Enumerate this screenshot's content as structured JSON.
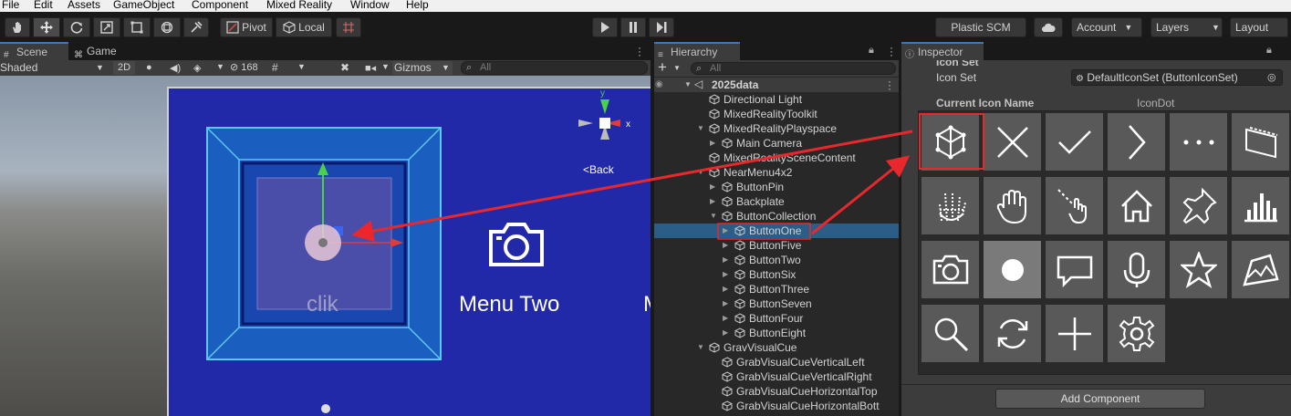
{
  "menu": [
    "File",
    "Edit",
    "Assets",
    "GameObject",
    "Component",
    "Mixed Reality",
    "Window",
    "Help"
  ],
  "toolbar": {
    "pivot_label": "Pivot",
    "local_label": "Local",
    "plastic_label": "Plastic SCM",
    "account_label": "Account",
    "layers_label": "Layers",
    "layout_label": "Layout"
  },
  "scene": {
    "tab_scene": "Scene",
    "tab_game": "Game",
    "shading_mode": "Shaded",
    "mode_2d": "2D",
    "hidden_count": "168",
    "gizmos_label": "Gizmos",
    "search_placeholder": "All",
    "back_label": "Back",
    "button_label_1": "clik",
    "button_label_2": "Menu Two",
    "button_label_3": "M"
  },
  "hierarchy": {
    "tab_label": "Hierarchy",
    "add_label": "+",
    "search_placeholder": "All",
    "scene_name": "2025data",
    "items": [
      {
        "label": "Directional Light",
        "depth": 1,
        "expander": ""
      },
      {
        "label": "MixedRealityToolkit",
        "depth": 1,
        "expander": ""
      },
      {
        "label": "MixedRealityPlayspace",
        "depth": 1,
        "expander": "open"
      },
      {
        "label": "Main Camera",
        "depth": 2,
        "expander": "closed"
      },
      {
        "label": "MixedRealitySceneContent",
        "depth": 1,
        "expander": ""
      },
      {
        "label": "NearMenu4x2",
        "depth": 1,
        "expander": "open"
      },
      {
        "label": "ButtonPin",
        "depth": 2,
        "expander": "closed"
      },
      {
        "label": "Backplate",
        "depth": 2,
        "expander": "closed"
      },
      {
        "label": "ButtonCollection",
        "depth": 2,
        "expander": "open"
      },
      {
        "label": "ButtonOne",
        "depth": 3,
        "expander": "closed",
        "selected": true
      },
      {
        "label": "ButtonFive",
        "depth": 3,
        "expander": "closed"
      },
      {
        "label": "ButtonTwo",
        "depth": 3,
        "expander": "closed"
      },
      {
        "label": "ButtonSix",
        "depth": 3,
        "expander": "closed"
      },
      {
        "label": "ButtonThree",
        "depth": 3,
        "expander": "closed"
      },
      {
        "label": "ButtonSeven",
        "depth": 3,
        "expander": "closed"
      },
      {
        "label": "ButtonFour",
        "depth": 3,
        "expander": "closed"
      },
      {
        "label": "ButtonEight",
        "depth": 3,
        "expander": "closed"
      },
      {
        "label": "GravVisualCue",
        "depth": 1,
        "expander": "open"
      },
      {
        "label": "GrabVisualCueVerticalLeft",
        "depth": 2,
        "expander": ""
      },
      {
        "label": "GrabVisualCueVerticalRight",
        "depth": 2,
        "expander": ""
      },
      {
        "label": "GrabVisualCueHorizontalTop",
        "depth": 2,
        "expander": ""
      },
      {
        "label": "GrabVisualCueHorizontalBott",
        "depth": 2,
        "expander": ""
      }
    ]
  },
  "inspector": {
    "tab_label": "Inspector",
    "section_header": "Icon Set",
    "icon_set_label": "Icon Set",
    "icon_set_value": "DefaultIconSet (ButtonIconSet)",
    "current_icon_label": "Current Icon Name",
    "current_icon_value": "IconDot",
    "add_component_label": "Add Component",
    "icons": [
      "cube-icon",
      "close-icon",
      "checkmark-icon",
      "chevron-right-icon",
      "ellipsis-icon",
      "panel-icon",
      "hand-ray-icon",
      "hand-icon",
      "hand-pointer-icon",
      "home-icon",
      "pin-icon",
      "bar-chart-icon",
      "camera-icon",
      "dot-icon",
      "comment-icon",
      "microphone-icon",
      "star-icon",
      "map-icon",
      "search-icon",
      "refresh-icon",
      "plus-icon",
      "gear-icon"
    ]
  },
  "colors": {
    "accent": "#3a79bb",
    "highlight_red": "#e8282c",
    "menu_blue": "#2229a8",
    "selection_row": "#2c5d87"
  }
}
